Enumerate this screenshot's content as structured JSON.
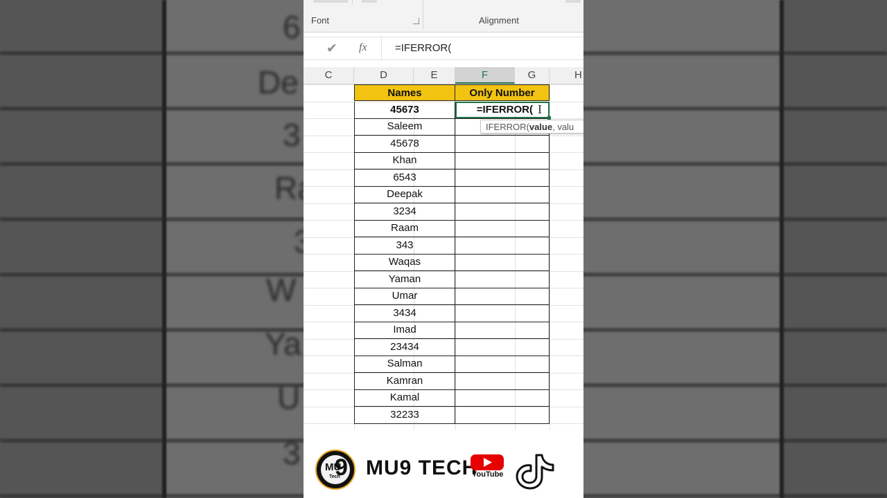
{
  "ribbon": {
    "groups": [
      {
        "label": "Font"
      },
      {
        "label": "Alignment"
      }
    ]
  },
  "formula_bar": {
    "value": "=IFERROR("
  },
  "columns": [
    "C",
    "D",
    "E",
    "F",
    "G",
    "H"
  ],
  "active_column": "F",
  "table": {
    "headers": [
      "Names",
      "Only Number"
    ],
    "rows": [
      "45673",
      "Saleem",
      "45678",
      "Khan",
      "6543",
      "Deepak",
      "3234",
      "Raam",
      "343",
      "Waqas",
      "Yaman",
      "Umar",
      "3434",
      "Imad",
      "23434",
      "Salman",
      "Kamran",
      "Kamal",
      "32233"
    ],
    "active_cell_value": "=IFERROR("
  },
  "tooltip": {
    "prefix": "IFERROR(",
    "arg_bold": "value",
    "rest": ", valu"
  },
  "brand": {
    "logo_mu": "MU",
    "logo_nine": "9",
    "logo_tech": "Tech",
    "name": "MU9 TECH",
    "youtube_label": "YouTube"
  },
  "colors": {
    "accent": "#217346",
    "header_fill": "#f2c311"
  },
  "background_text": [
    {
      "text": "6"
    },
    {
      "text": "De"
    },
    {
      "text": "3"
    },
    {
      "text": "Ra"
    },
    {
      "text": "3"
    },
    {
      "text": "W"
    },
    {
      "text": "Ya"
    },
    {
      "text": "U"
    },
    {
      "text": "3"
    }
  ]
}
